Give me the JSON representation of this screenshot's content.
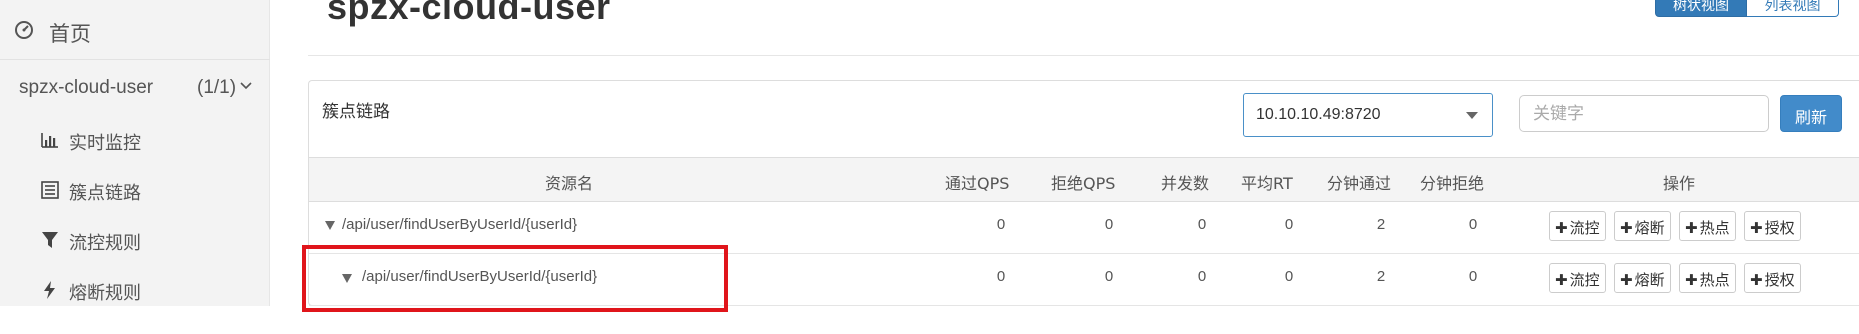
{
  "sidebar": {
    "home": {
      "label": "首页",
      "icon": "dashboard-icon"
    },
    "app": {
      "name": "spzx-cloud-user",
      "count": "(1/1)",
      "icon": "chevron-down-icon"
    },
    "items": [
      {
        "label": "实时监控",
        "icon": "bar-chart-icon"
      },
      {
        "label": "簇点链路",
        "icon": "list-icon"
      },
      {
        "label": "流控规则",
        "icon": "filter-icon"
      },
      {
        "label": "熔断规则",
        "icon": "bolt-icon"
      }
    ]
  },
  "header": {
    "title": "spzx-cloud-user",
    "view_toggle": [
      "树状视图",
      "列表视图"
    ]
  },
  "panel": {
    "title": "簇点链路",
    "machine": "10.10.10.49:8720",
    "keyword_placeholder": "关键字",
    "keyword_value": "",
    "refresh_label": "刷新"
  },
  "table": {
    "columns": [
      "资源名",
      "通过QPS",
      "拒绝QPS",
      "并发数",
      "平均RT",
      "分钟通过",
      "分钟拒绝",
      "操作"
    ],
    "rows": [
      {
        "resource": "/api/user/findUserByUserId/{userId}",
        "pass_qps": "0",
        "block_qps": "0",
        "concurrency": "0",
        "avg_rt": "0",
        "minute_pass": "2",
        "minute_block": "0"
      },
      {
        "resource": "/api/user/findUserByUserId/{userId}",
        "pass_qps": "0",
        "block_qps": "0",
        "concurrency": "0",
        "avg_rt": "0",
        "minute_pass": "2",
        "minute_block": "0"
      }
    ],
    "actions": [
      "流控",
      "熔断",
      "热点",
      "授权"
    ]
  },
  "colors": {
    "accent": "#337ab7",
    "refresh": "#428bca",
    "highlight": "#e0151b",
    "sidebar_bg": "#f3f3f3"
  }
}
